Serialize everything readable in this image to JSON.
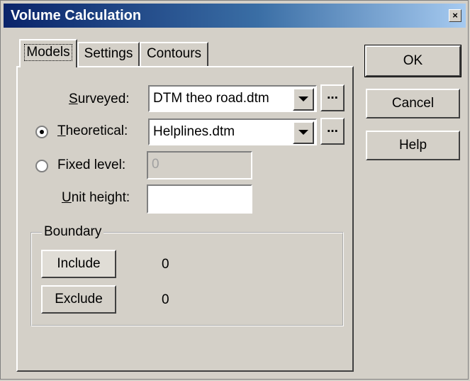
{
  "window": {
    "title": "Volume Calculation",
    "close_glyph": "×"
  },
  "tabs": [
    {
      "label": "Models"
    },
    {
      "label": "Settings"
    },
    {
      "label": "Contours"
    }
  ],
  "buttons": {
    "ok": "OK",
    "cancel": "Cancel",
    "help": "Help"
  },
  "models": {
    "surveyed": {
      "label": "Surveyed:",
      "value": "DTM theo road.dtm"
    },
    "theoretical": {
      "label": "Theoretical:",
      "value": "Helplines.dtm",
      "selected": true
    },
    "fixed_level": {
      "label": "Fixed level:",
      "value": "0",
      "selected": false
    },
    "unit_height": {
      "label": "Unit height:",
      "value": ""
    },
    "browse_label": "..."
  },
  "boundary": {
    "title": "Boundary",
    "include_label": "Include",
    "include_count": "0",
    "exclude_label": "Exclude",
    "exclude_count": "0"
  }
}
